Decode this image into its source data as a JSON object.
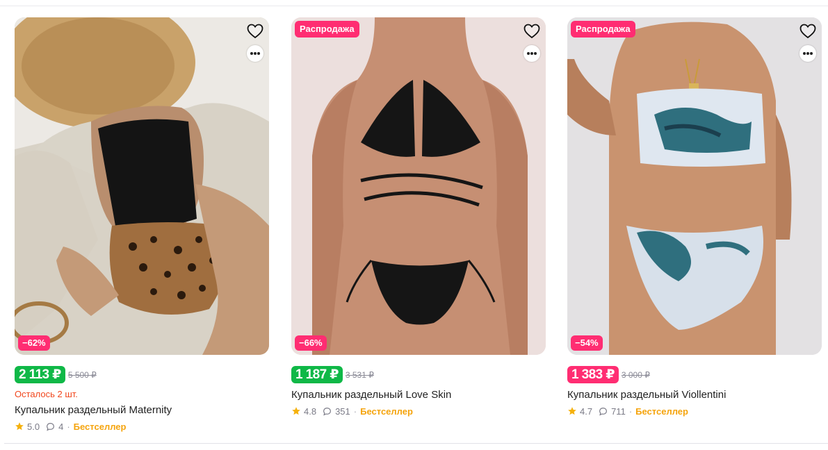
{
  "colors": {
    "green_price": "#0fb847",
    "pink_price": "#ff2d72",
    "sale_badge": "#ff2d72",
    "bestseller": "#f5a40d",
    "stock_warning": "#f1461c"
  },
  "products": [
    {
      "sale_label": "",
      "discount": "−62%",
      "price": "2 113 ₽",
      "old_price": "5 500 ₽",
      "price_style": "green",
      "stock": "Осталось 2 шт.",
      "title": "Купальник раздельный Maternity",
      "rating": "5.0",
      "reviews": "4",
      "badge": "Бестселлер",
      "image_icon": "black-top-leopard-bottom-swimsuit",
      "favorite_icon": "heart-icon",
      "more_icon": "more-dots-icon"
    },
    {
      "sale_label": "Распродажа",
      "discount": "−66%",
      "price": "1 187 ₽",
      "old_price": "3 531 ₽",
      "price_style": "green",
      "stock": "",
      "title": "Купальник раздельный Love Skin",
      "rating": "4.8",
      "reviews": "351",
      "badge": "Бестселлер",
      "image_icon": "black-strappy-bikini",
      "favorite_icon": "heart-icon",
      "more_icon": "more-dots-icon"
    },
    {
      "sale_label": "Распродажа",
      "discount": "−54%",
      "price": "1 383 ₽",
      "old_price": "3 000 ₽",
      "price_style": "pink",
      "stock": "",
      "title": "Купальник раздельный Viollentini",
      "rating": "4.7",
      "reviews": "711",
      "badge": "Бестселлер",
      "image_icon": "marble-print-bikini",
      "favorite_icon": "heart-icon",
      "more_icon": "more-dots-icon"
    }
  ]
}
